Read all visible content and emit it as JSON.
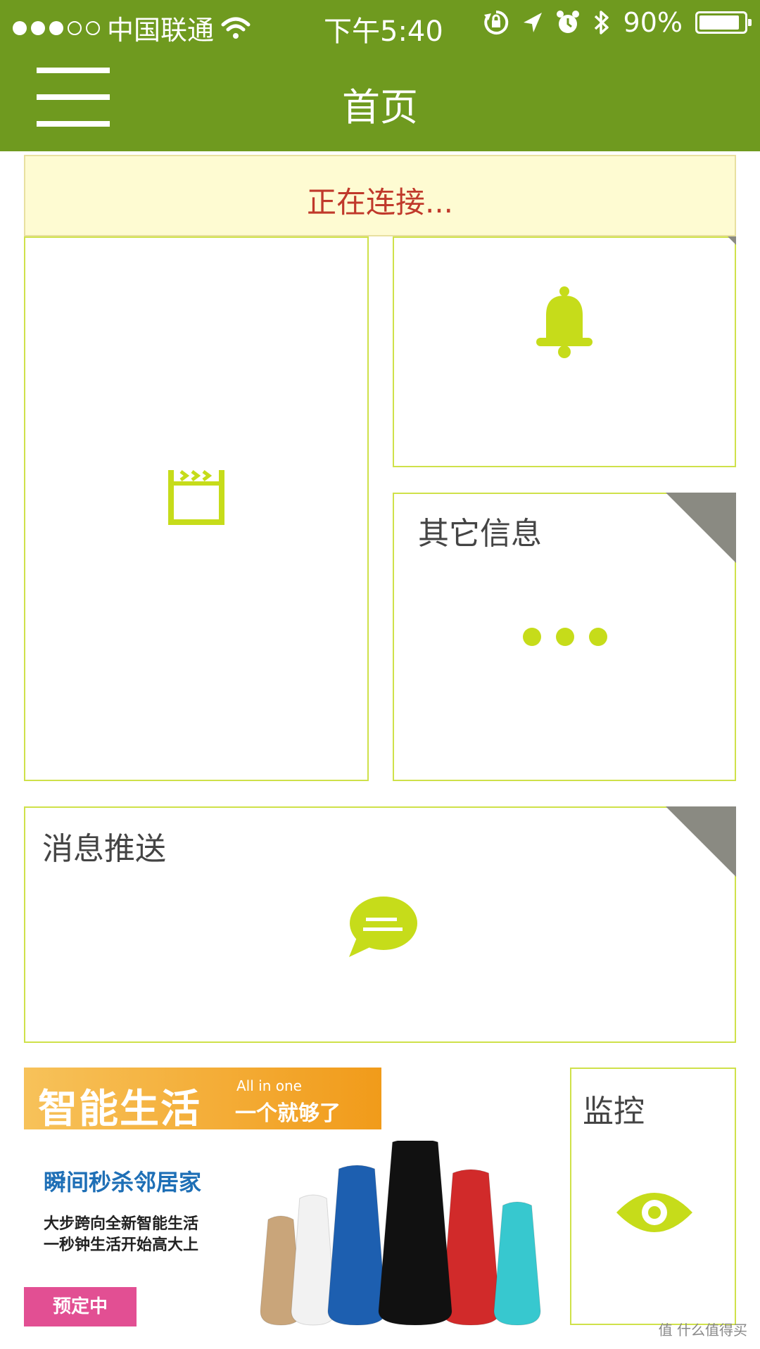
{
  "status_bar": {
    "carrier": "中国联通",
    "time": "下午5:40",
    "battery": "90%",
    "battery_level": 0.9,
    "signal_bars_filled": 3,
    "signal_bars_total": 5,
    "icons": [
      "wifi-icon",
      "rotation-lock-icon",
      "location-icon",
      "alarm-icon",
      "bluetooth-icon",
      "battery-icon"
    ]
  },
  "nav": {
    "title": "首页",
    "menu_icon": "hamburger-menu-icon"
  },
  "connection_banner": {
    "text": "正在连接..."
  },
  "tiles": {
    "video": {
      "icon": "clapperboard-icon"
    },
    "alarm": {
      "icon": "bell-icon"
    },
    "other_info": {
      "title": "其它信息",
      "icon": "more-dots-icon"
    },
    "message_push": {
      "title": "消息推送",
      "icon": "chat-bubble-icon"
    },
    "monitor": {
      "title": "监控",
      "icon": "eye-icon"
    }
  },
  "promo": {
    "main": "智能生活",
    "sub1": "All in one",
    "sub2": "一个就够了",
    "headline": "瞬间秒杀邻居家",
    "line1": "大步跨向全新智能生活",
    "line2": "一秒钟生活开始高大上",
    "button": "预定中",
    "product_colors": [
      "#c9a57a",
      "#f2f2f2",
      "#1d5fb0",
      "#111111",
      "#d12a2a",
      "#37c8cf"
    ]
  },
  "watermark": "值 什么值得买",
  "colors": {
    "header": "#6f9a1f",
    "accent": "#c6dc1a",
    "tile_border": "#cfe14a",
    "connect_text": "#c0392b",
    "corner_triangle": "#8a8a82"
  }
}
